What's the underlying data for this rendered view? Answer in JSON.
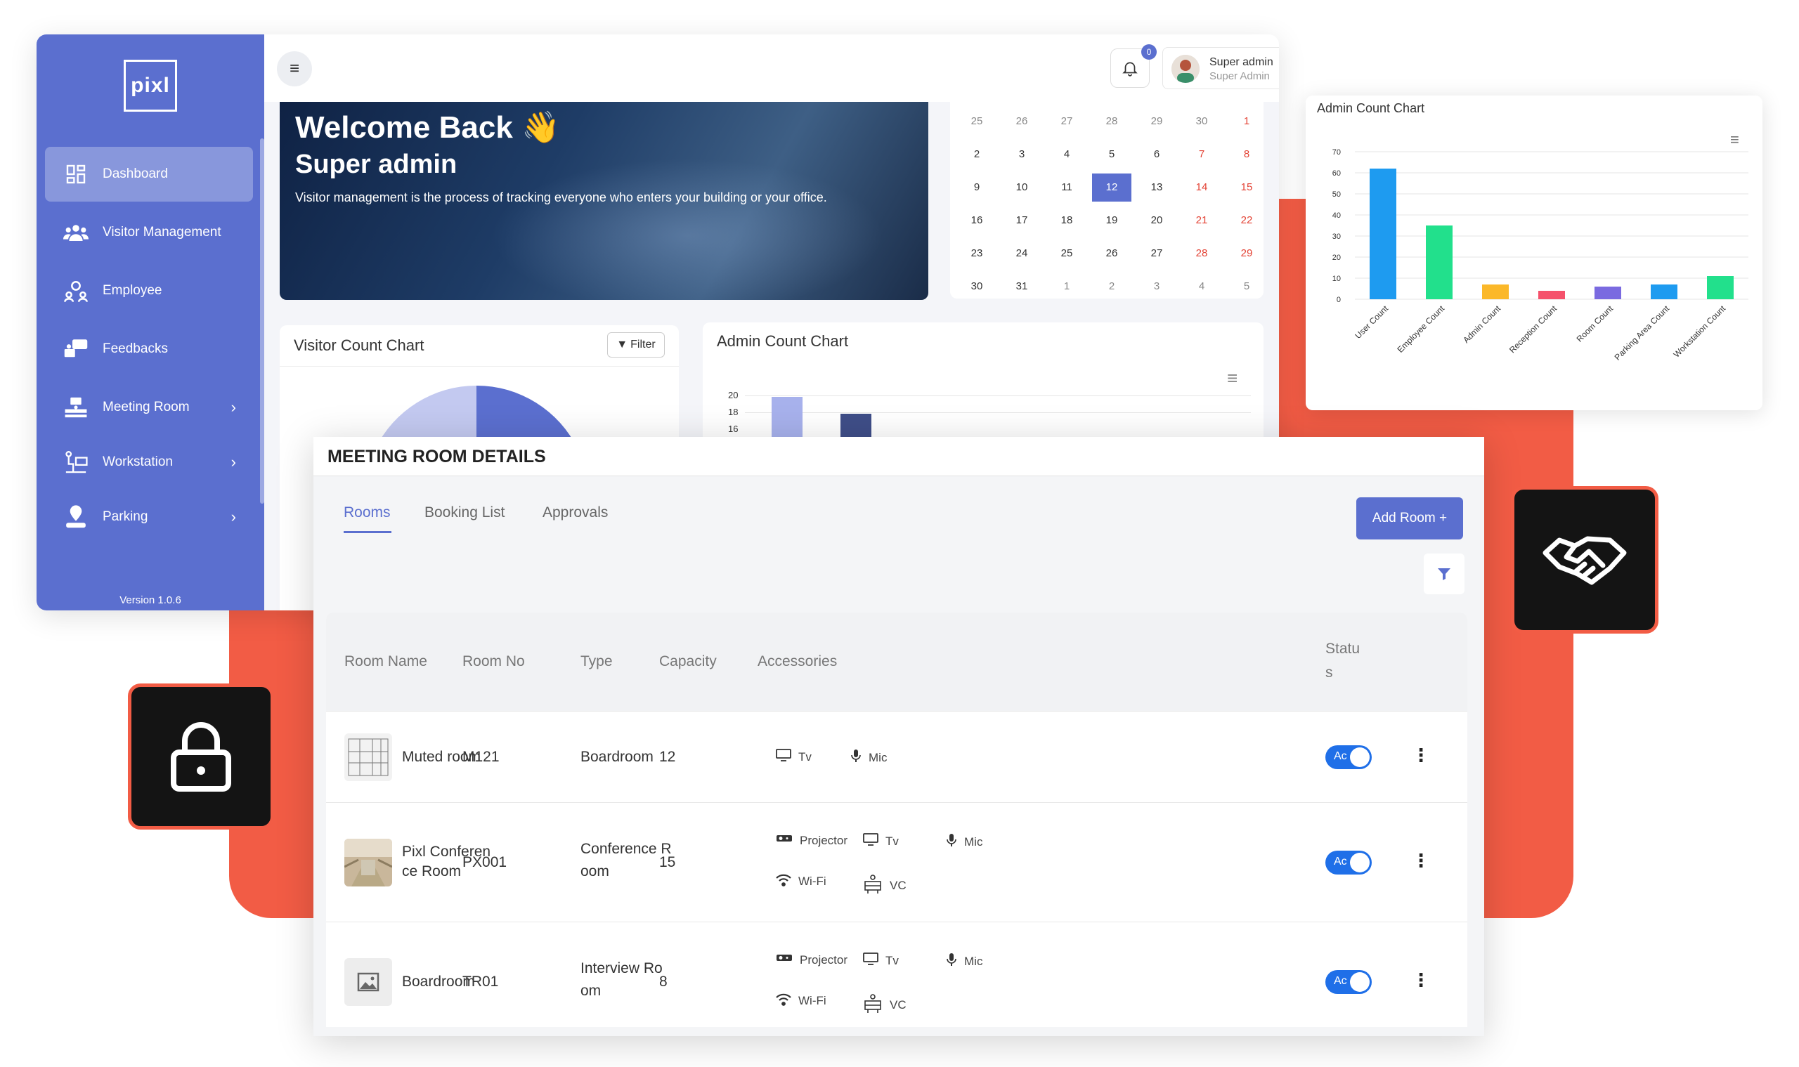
{
  "brand": {
    "logo_text": "pixl",
    "version": "Version 1.0.6"
  },
  "sidebar": {
    "items": [
      {
        "label": "Dashboard",
        "icon": "dashboard-icon",
        "active": true,
        "chevron": false
      },
      {
        "label": "Visitor Management",
        "icon": "users-icon",
        "active": false,
        "chevron": false
      },
      {
        "label": "Employee",
        "icon": "employee-icon",
        "active": false,
        "chevron": false
      },
      {
        "label": "Feedbacks",
        "icon": "feedback-icon",
        "active": false,
        "chevron": false
      },
      {
        "label": "Meeting Room",
        "icon": "meeting-room-icon",
        "active": false,
        "chevron": true
      },
      {
        "label": "Workstation",
        "icon": "workstation-icon",
        "active": false,
        "chevron": true
      },
      {
        "label": "Parking",
        "icon": "parking-icon",
        "active": false,
        "chevron": true
      }
    ]
  },
  "header": {
    "notification_count": "0",
    "user_name": "Super admin",
    "user_role": "Super Admin"
  },
  "banner": {
    "title": "Welcome Back 👋",
    "subtitle": "Super admin",
    "text": "Visitor management is the process of tracking everyone who enters your building or your office."
  },
  "calendar": {
    "weeks": [
      [
        "25",
        "26",
        "27",
        "28",
        "29",
        "30",
        "1"
      ],
      [
        "2",
        "3",
        "4",
        "5",
        "6",
        "7",
        "8"
      ],
      [
        "9",
        "10",
        "11",
        "12",
        "13",
        "14",
        "15"
      ],
      [
        "16",
        "17",
        "18",
        "19",
        "20",
        "21",
        "22"
      ],
      [
        "23",
        "24",
        "25",
        "26",
        "27",
        "28",
        "29"
      ],
      [
        "30",
        "31",
        "1",
        "2",
        "3",
        "4",
        "5"
      ]
    ],
    "selected": "12"
  },
  "visitor_chart": {
    "title": "Visitor Count Chart",
    "filter_label": "Filter"
  },
  "admin_chart_small": {
    "title": "Admin Count Chart",
    "ticks": [
      "20",
      "18",
      "16"
    ]
  },
  "chart_data": {
    "type": "bar",
    "title": "Admin Count Chart",
    "categories": [
      "User Count",
      "Employee Count",
      "Admin Count",
      "Reception Count",
      "Room Count",
      "Parking Area Count",
      "Workstation Count"
    ],
    "values": [
      62,
      35,
      7,
      4,
      6,
      7,
      11
    ],
    "colors": [
      "#1e9bf0",
      "#22e08c",
      "#fbb829",
      "#f5516b",
      "#7a6ae0",
      "#1e9bf0",
      "#22e08c"
    ],
    "ylim": [
      0,
      70
    ],
    "yticks": [
      "70",
      "60",
      "50",
      "40",
      "30",
      "20",
      "10",
      "0"
    ],
    "grid": true,
    "xlabel": "",
    "ylabel": ""
  },
  "meeting_room": {
    "title": "MEETING ROOM DETAILS",
    "tabs": [
      "Rooms",
      "Booking List",
      "Approvals"
    ],
    "add_button": "Add Room +",
    "columns": {
      "name": "Room Name",
      "number": "Room No",
      "type": "Type",
      "capacity": "Capacity",
      "accessories": "Accessories",
      "status_1": "Statu",
      "status_2": "s"
    },
    "rows": [
      {
        "name_1": "Muted room",
        "name_2": "",
        "number": "M121",
        "type_1": "Boardroom",
        "type_2": "",
        "capacity": "12",
        "accessories": [
          {
            "label": "Tv",
            "icon": "tv-icon"
          },
          {
            "label": "Mic",
            "icon": "mic-icon"
          }
        ],
        "status": "Ac"
      },
      {
        "name_1": "Pixl Conferen",
        "name_2": "ce Room",
        "number": "PX001",
        "type_1": "Conference R",
        "type_2": "oom",
        "capacity": "15",
        "accessories": [
          {
            "label": "Projector",
            "icon": "projector-icon"
          },
          {
            "label": "Tv",
            "icon": "tv-icon"
          },
          {
            "label": "Mic",
            "icon": "mic-icon"
          },
          {
            "label": "Wi-Fi",
            "icon": "wifi-icon"
          },
          {
            "label": "VC",
            "icon": "vc-icon"
          }
        ],
        "status": "Ac"
      },
      {
        "name_1": "Boardroom",
        "name_2": "",
        "number": "TR01",
        "type_1": "Interview Ro",
        "type_2": "om",
        "capacity": "8",
        "accessories": [
          {
            "label": "Projector",
            "icon": "projector-icon"
          },
          {
            "label": "Tv",
            "icon": "tv-icon"
          },
          {
            "label": "Mic",
            "icon": "mic-icon"
          },
          {
            "label": "Wi-Fi",
            "icon": "wifi-icon"
          },
          {
            "label": "VC",
            "icon": "vc-icon"
          }
        ],
        "status": "Ac"
      }
    ]
  },
  "colors": {
    "brand": "#5b6fcf",
    "accent": "#f25c45",
    "toggle": "#1f6fe8"
  }
}
